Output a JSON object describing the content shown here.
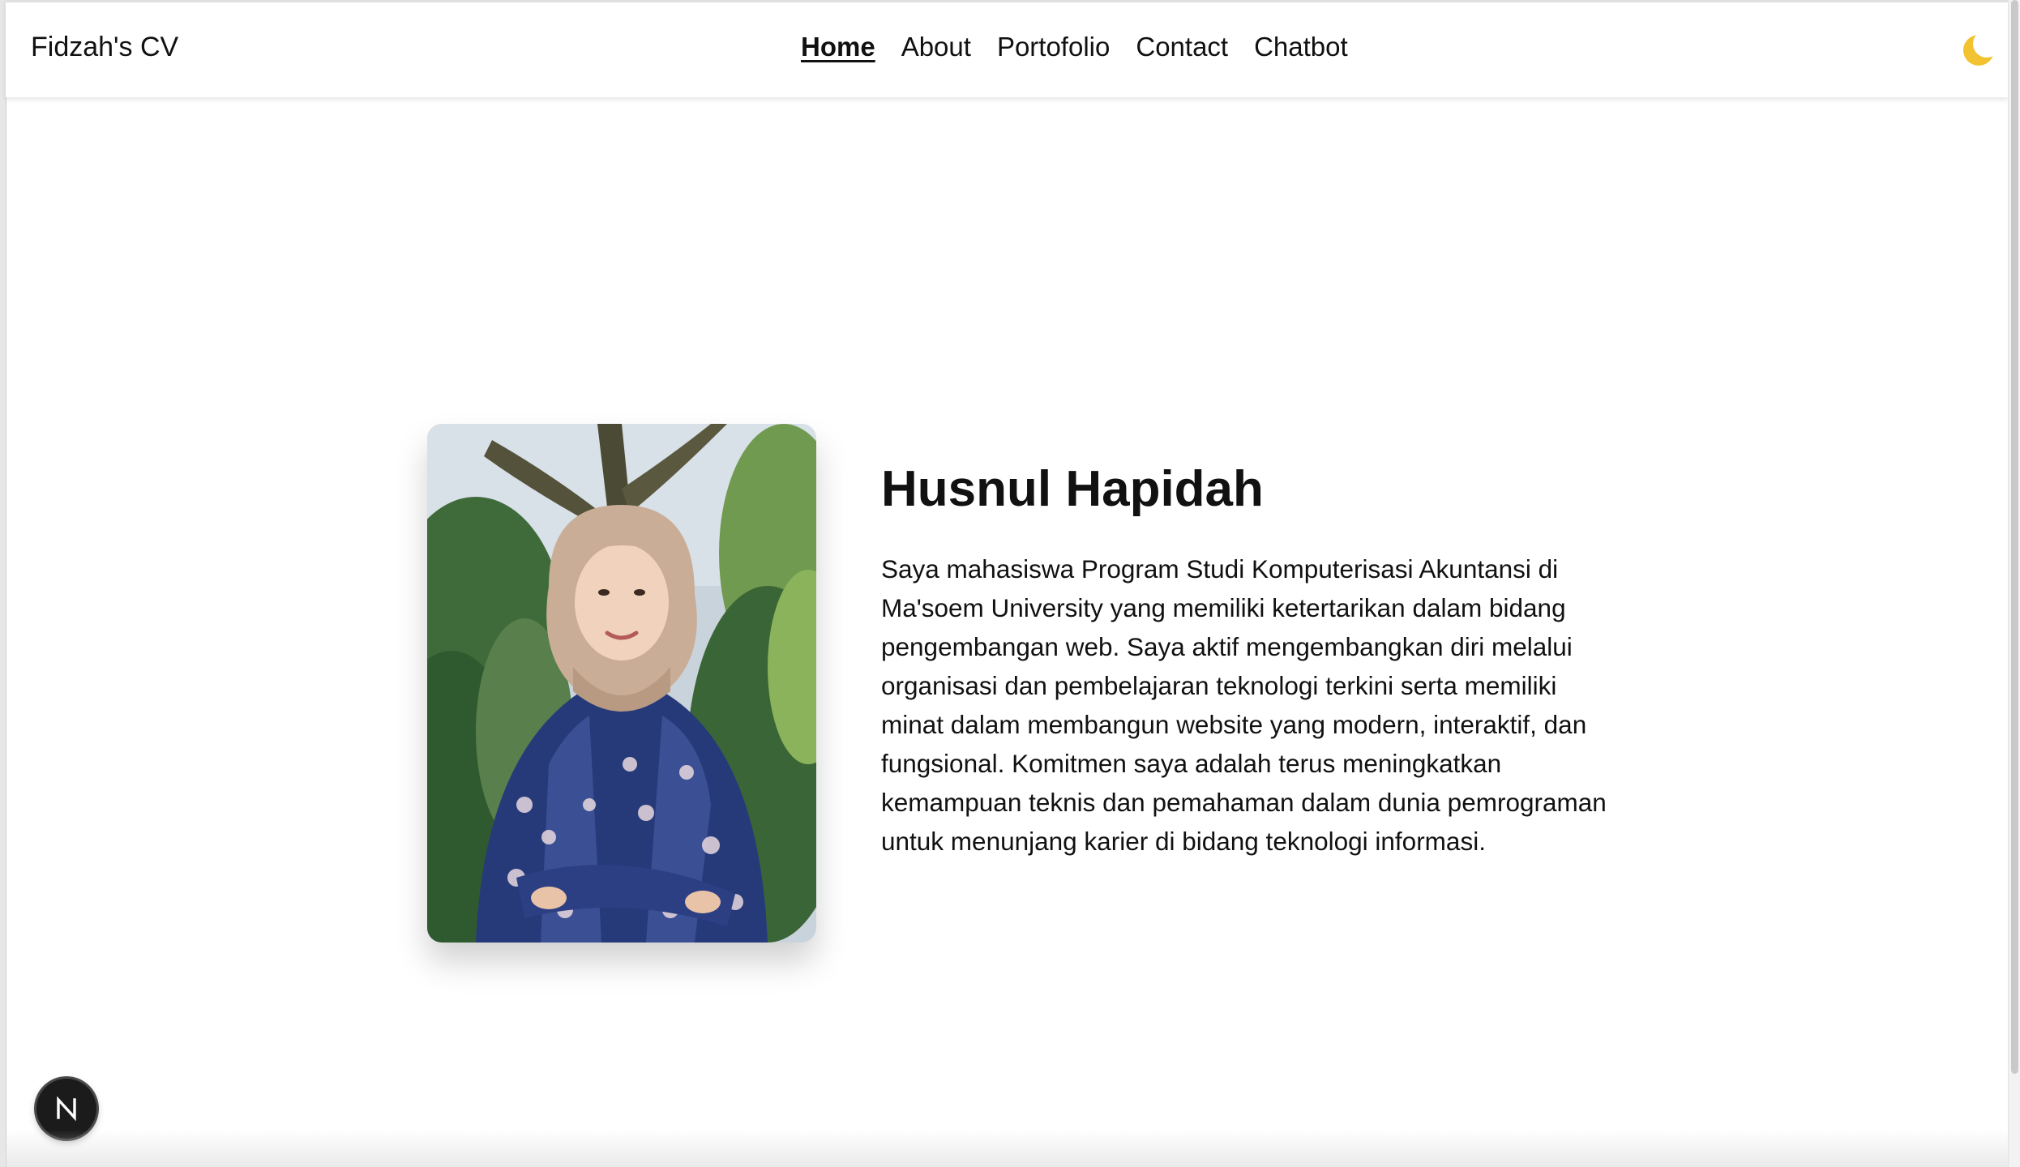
{
  "header": {
    "brand": "Fidzah's CV",
    "nav": [
      {
        "label": "Home",
        "active": true
      },
      {
        "label": "About",
        "active": false
      },
      {
        "label": "Portofolio",
        "active": false
      },
      {
        "label": "Contact",
        "active": false
      },
      {
        "label": "Chatbot",
        "active": false
      }
    ],
    "theme_toggle_icon": "moon-icon"
  },
  "hero": {
    "name": "Husnul Hapidah",
    "bio": "Saya mahasiswa Program Studi Komputerisasi Akuntansi di Ma'soem University yang memiliki ketertarikan dalam bidang pengembangan web. Saya aktif mengembangkan diri melalui organisasi dan pembelajaran teknologi terkini serta memiliki minat dalam membangun website yang modern, interaktif, dan fungsional. Komitmen saya adalah terus meningkatkan kemampuan teknis dan pemahaman dalam dunia pemrograman untuk menunjang karier di bidang teknologi informasi.",
    "photo_icon": "profile-photo"
  },
  "badge": {
    "icon": "nextjs-icon"
  },
  "colors": {
    "text": "#111111",
    "background": "#ffffff",
    "moon": "#f2c230",
    "badge": "#1b1b1b"
  }
}
